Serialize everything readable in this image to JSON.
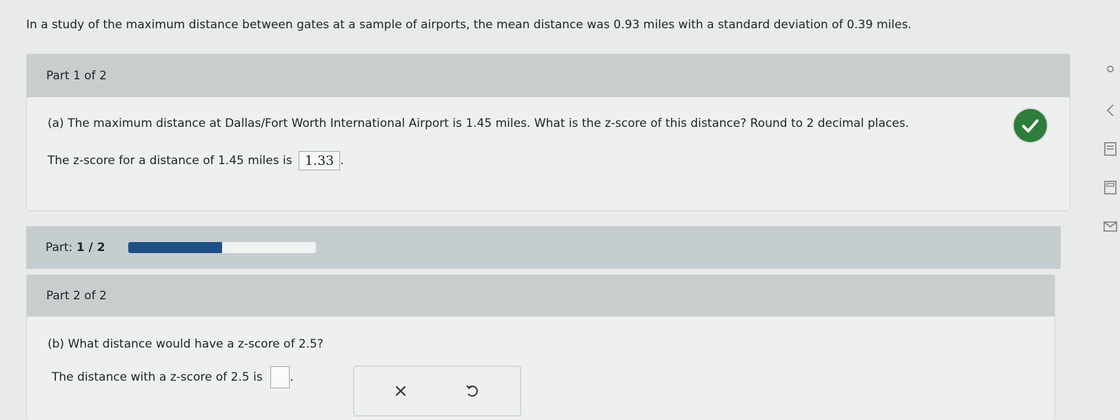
{
  "intro_text": "In a study of the maximum distance between gates at a sample of airports, the mean distance was 0.93 miles with a standard deviation of 0.39 miles.",
  "part1": {
    "header": "Part 1 of 2",
    "question": "(a) The maximum distance at Dallas/Fort Worth International Airport is 1.45 miles. What is the z-score of this distance? Round to 2 decimal places.",
    "answer_prefix": "The z-score for a distance of 1.45 miles is",
    "answer_value": "1.33",
    "answer_suffix": "."
  },
  "progress": {
    "label": "Part:",
    "current": "1 / 2",
    "fraction": 0.5,
    "fill_color": "#1e4f86"
  },
  "part2": {
    "header": "Part 2 of 2",
    "question": "(b) What distance would have a z-score of 2.5?",
    "answer_prefix": "The distance with a z-score of 2.5 is",
    "answer_suffix": "."
  },
  "tools": {
    "clear_icon": "×",
    "undo_icon": "undo-icon"
  },
  "colors": {
    "check_green": "#2e7d3b"
  }
}
